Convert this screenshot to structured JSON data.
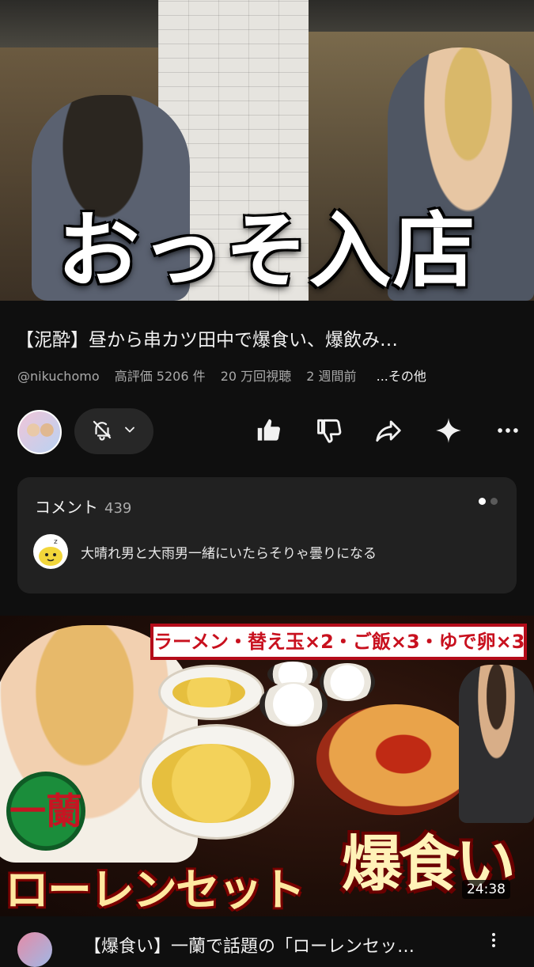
{
  "current_video": {
    "overlay_caption": "おっそ入店",
    "title": "【泥酔】昼から串カツ田中で爆食い、爆飲み…",
    "channel_handle": "@nikuchomo",
    "likes_text": "高評価 5206 件",
    "views_text": "20 万回視聴",
    "age_text": "2 週間前",
    "more_label": "...その他"
  },
  "actions": {
    "like_icon": "thumbs-up-icon",
    "dislike_icon": "thumbs-down-icon",
    "share_icon": "share-icon",
    "remix_icon": "sparkle-icon",
    "more_icon": "more-horizontal-icon",
    "bell_icon": "bell-off-icon"
  },
  "comments": {
    "header": "コメント",
    "count": "439",
    "top_comment": "大晴れ男と大雨男一緒にいたらそりゃ曇りになる"
  },
  "next_video": {
    "banner_text": "ラーメン・替え玉×2・ご飯×3・ゆで卵×3",
    "logo_text": "一蘭",
    "caption_left": "ローレンセット",
    "caption_right": "爆食い",
    "duration": "24:38",
    "title": "【爆食い】一蘭で話題の「ローレンセッ…"
  },
  "colors": {
    "background": "#0f0f0f",
    "card": "#212121",
    "secondary_text": "#aaaaaa",
    "banner_red": "#c8101e"
  }
}
